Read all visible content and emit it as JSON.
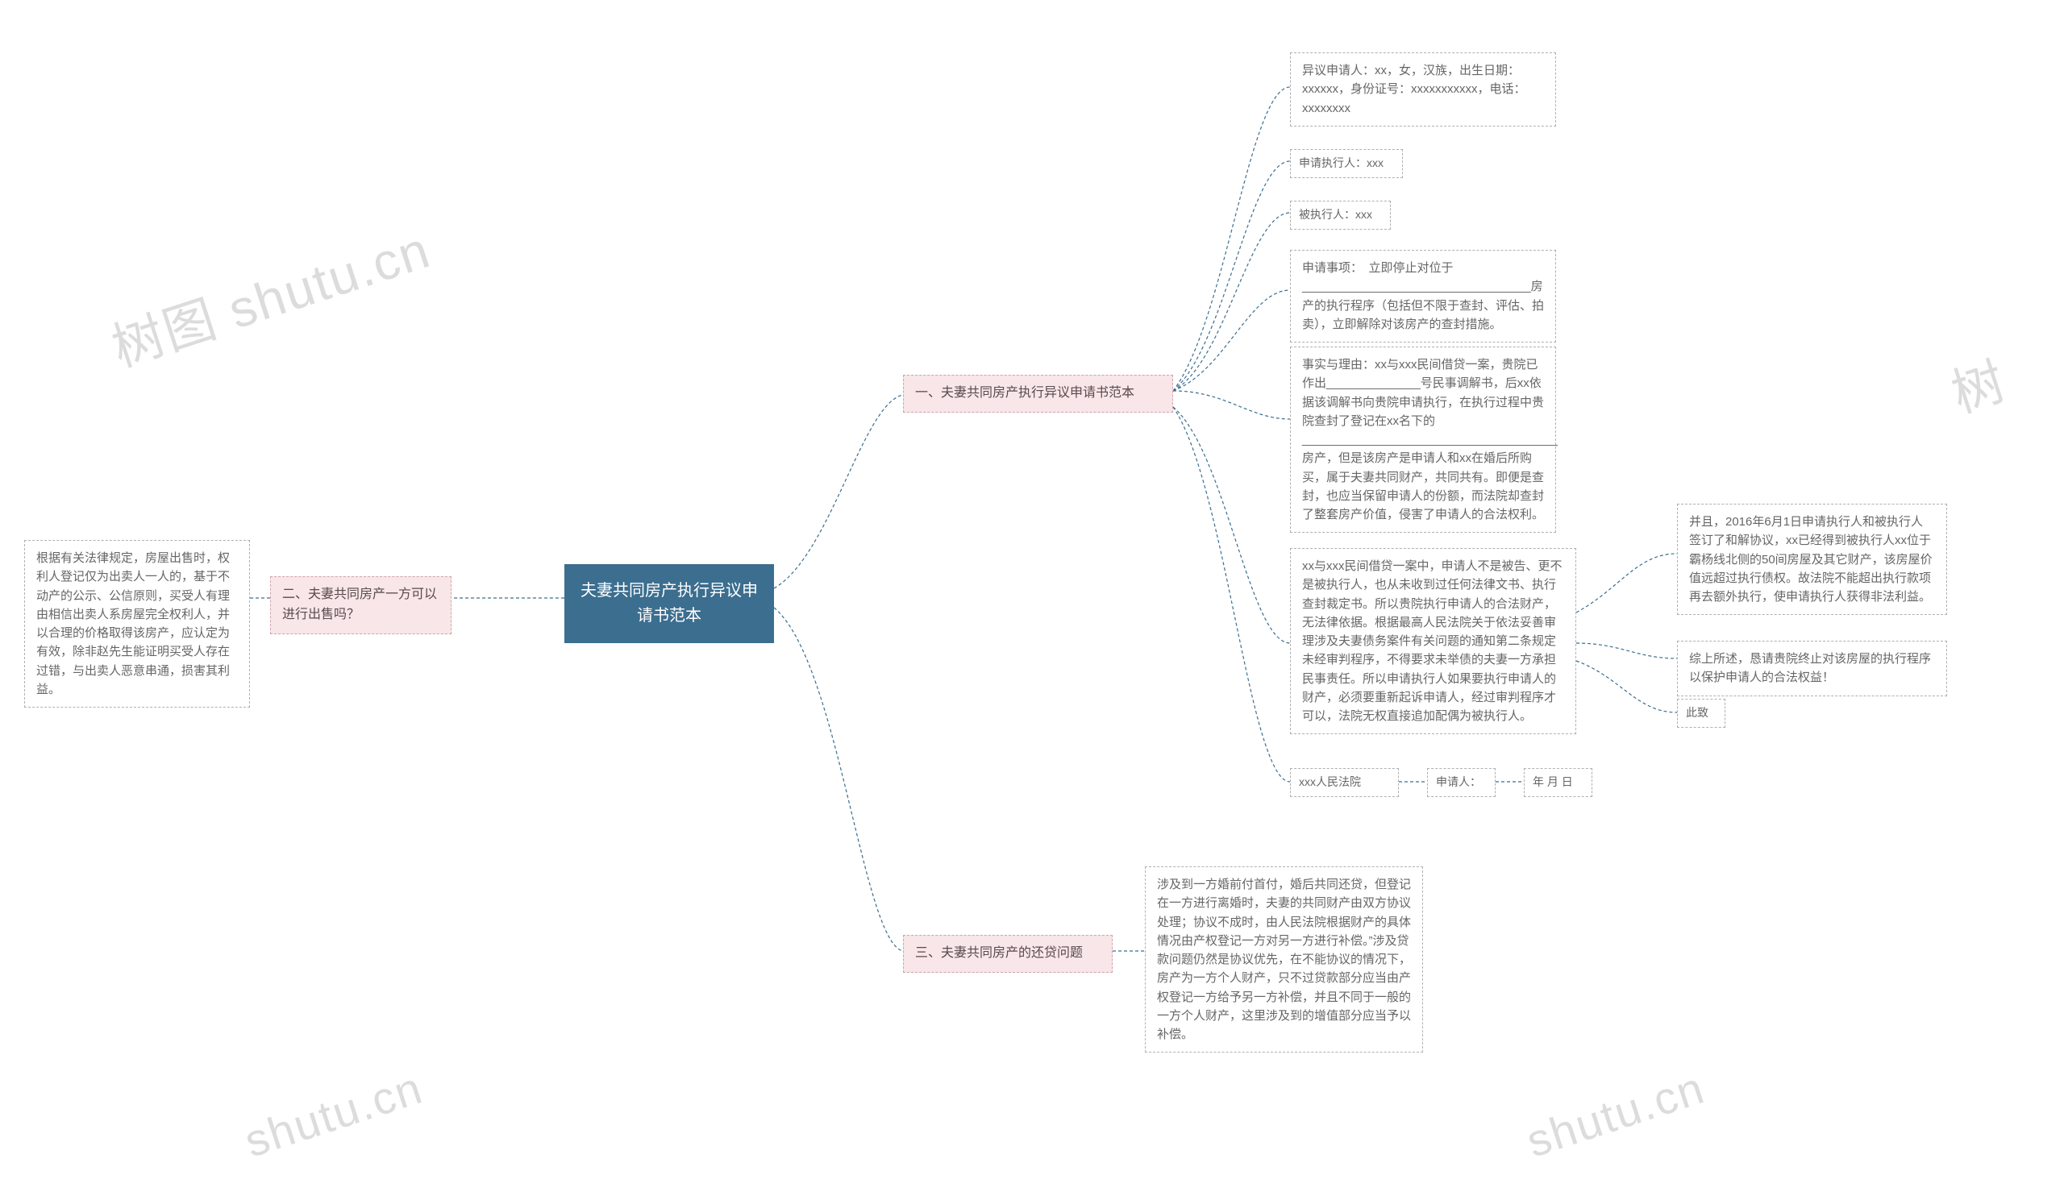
{
  "root": {
    "title": "夫妻共同房产执行异议申请书范本"
  },
  "section1": {
    "title": "一、夫妻共同房产执行异议申请书范本",
    "item1": "异议申请人：xx，女，汉族，出生日期：xxxxxx，身份证号：xxxxxxxxxxx，电话：xxxxxxxx",
    "item2": "申请执行人：xxx",
    "item3": "被执行人：xxx",
    "item4": "申请事项：　立即停止对位于__________________________________房产的执行程序（包括但不限于查封、评估、拍卖），立即解除对该房产的查封措施。",
    "item5": "事实与理由：xx与xxx民间借贷一案，贵院已作出______________号民事调解书，后xx依据该调解书向贵院申请执行，在执行过程中贵院查封了登记在xx名下的______________________________________房产，但是该房产是申请人和xx在婚后所购买，属于夫妻共同财产，共同共有。即便是查封，也应当保留申请人的份额，而法院却查封了整套房产价值，侵害了申请人的合法权利。",
    "item6": "xx与xxx民间借贷一案中，申请人不是被告、更不是被执行人，也从未收到过任何法律文书、执行查封裁定书。所以贵院执行申请人的合法财产，无法律依据。根据最高人民法院关于依法妥善审理涉及夫妻债务案件有关问题的通知第二条规定未经审判程序，不得要求未举债的夫妻一方承担民事责任。所以申请执行人如果要执行申请人的财产，必须要重新起诉申请人，经过审判程序才可以，法院无权直接追加配偶为被执行人。",
    "child6_1": "并且，2016年6月1日申请执行人和被执行人签订了和解协议，xx已经得到被执行人xx位于霸杨线北侧的50间房屋及其它财产，该房屋价值远超过执行债权。故法院不能超出执行款项再去额外执行，使申请执行人获得非法利益。",
    "child6_2": "综上所述，恳请贵院终止对该房屋的执行程序以保护申请人的合法权益！",
    "child6_3": "此致",
    "item7": "xxx人民法院",
    "item7_1": "申请人：",
    "item7_2": "年 月 日"
  },
  "section2": {
    "title": "二、夫妻共同房产一方可以进行出售吗？",
    "body": "根据有关法律规定，房屋出售时，权利人登记仅为出卖人一人的，基于不动产的公示、公信原则，买受人有理由相信出卖人系房屋完全权利人，并以合理的价格取得该房产，应认定为有效，除非赵先生能证明买受人存在过错，与出卖人恶意串通，损害其利益。"
  },
  "section3": {
    "title": "三、夫妻共同房产的还贷问题",
    "body": "涉及到一方婚前付首付，婚后共同还贷，但登记在一方进行离婚时，夫妻的共同财产由双方协议处理；协议不成时，由人民法院根据财产的具体情况由产权登记一方对另一方进行补偿。”涉及贷款问题仍然是协议优先，在不能协议的情况下，房产为一方个人财产，只不过贷款部分应当由产权登记一方给予另一方补偿，并且不同于一般的一方个人财产，这里涉及到的增值部分应当予以补偿。"
  },
  "watermarks": {
    "w1": "树图 shutu.cn",
    "w2": "树",
    "w3": "shutu.cn",
    "w4": "shutu.cn"
  }
}
